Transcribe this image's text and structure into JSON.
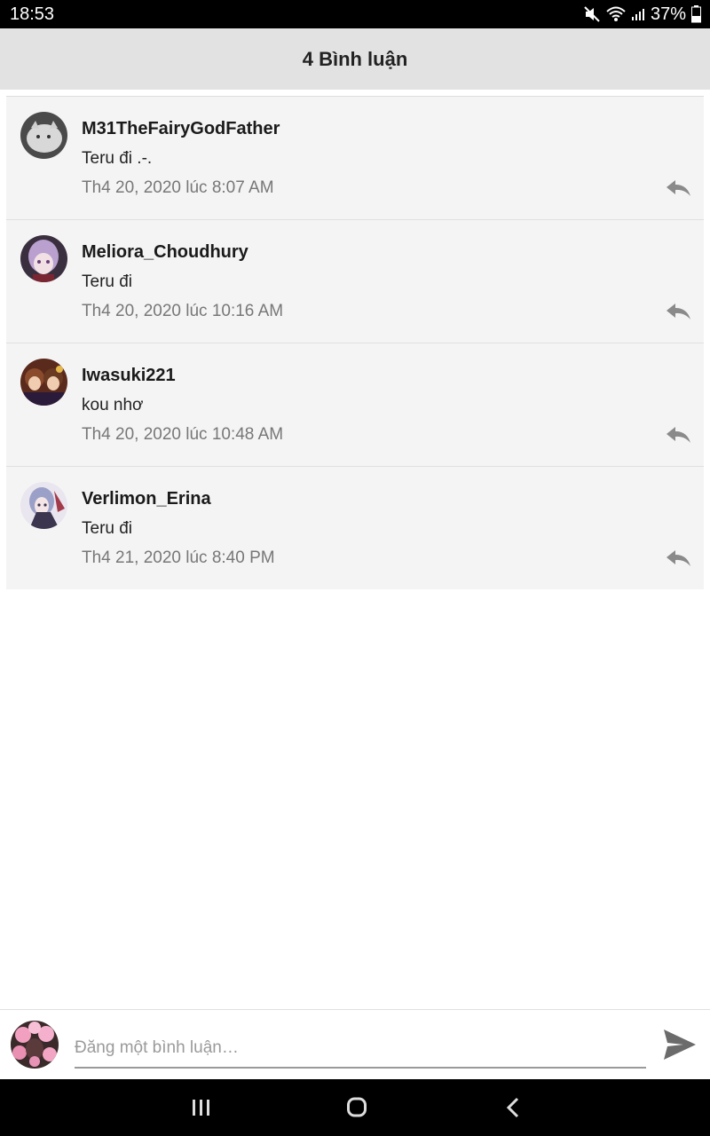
{
  "status": {
    "time": "18:53",
    "battery": "37%"
  },
  "header": {
    "title": "4 Bình luận"
  },
  "comments": [
    {
      "name": "M31TheFairyGodFather",
      "text": "Teru đi .-.",
      "time": "Th4 20, 2020 lúc 8:07 AM"
    },
    {
      "name": "Meliora_Choudhury",
      "text": "Teru đi",
      "time": "Th4 20, 2020 lúc 10:16 AM"
    },
    {
      "name": "Iwasuki221",
      "text": "kou nhơ",
      "time": "Th4 20, 2020 lúc 10:48 AM"
    },
    {
      "name": "Verlimon_Erina",
      "text": "Teru đi",
      "time": "Th4 21, 2020 lúc 8:40 PM"
    }
  ],
  "composer": {
    "placeholder": "Đăng một bình luận…",
    "value": ""
  },
  "icons": {
    "reply": "reply-icon",
    "send": "send-icon",
    "nav_recent": "recent-apps-icon",
    "nav_home": "home-icon",
    "nav_back": "back-icon"
  },
  "colors": {
    "header_bg": "#e2e2e2",
    "list_bg": "#f4f4f4",
    "meta_text": "#777777",
    "icon_gray": "#8a8a8a"
  }
}
